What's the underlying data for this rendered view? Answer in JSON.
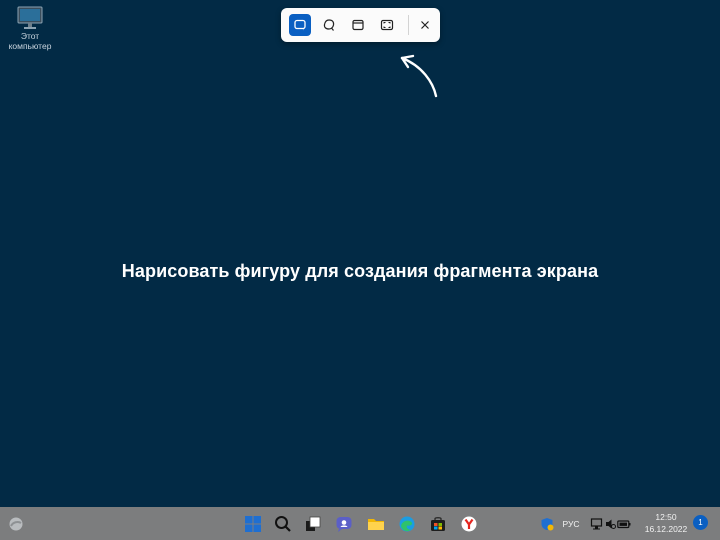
{
  "desktop": {
    "icon_label": "Этот компьютер",
    "icon": "monitor-icon"
  },
  "snip_toolbar": {
    "modes": [
      {
        "icon": "rectangle-snip-icon",
        "active": true
      },
      {
        "icon": "freeform-snip-icon",
        "active": false
      },
      {
        "icon": "window-snip-icon",
        "active": false
      },
      {
        "icon": "fullscreen-snip-icon",
        "active": false
      }
    ],
    "close_icon": "close-icon",
    "accent": "#0a5fc2"
  },
  "prompt": "Нарисовать фигуру для создания фрагмента экрана",
  "taskbar": {
    "widgets_icon": "weather-widget-icon",
    "apps": [
      "windows-start-icon",
      "search-icon",
      "task-view-icon",
      "chat-icon",
      "file-explorer-icon",
      "edge-icon",
      "store-icon",
      "yandex-browser-icon"
    ],
    "tray": {
      "security_icon": "defender-icon",
      "language": "РУС",
      "clock_time": "12:50",
      "clock_date": "16.12.2022",
      "notification_count": "1"
    }
  },
  "colors": {
    "background": "#022a45",
    "taskbar": "#7c7d7e"
  }
}
